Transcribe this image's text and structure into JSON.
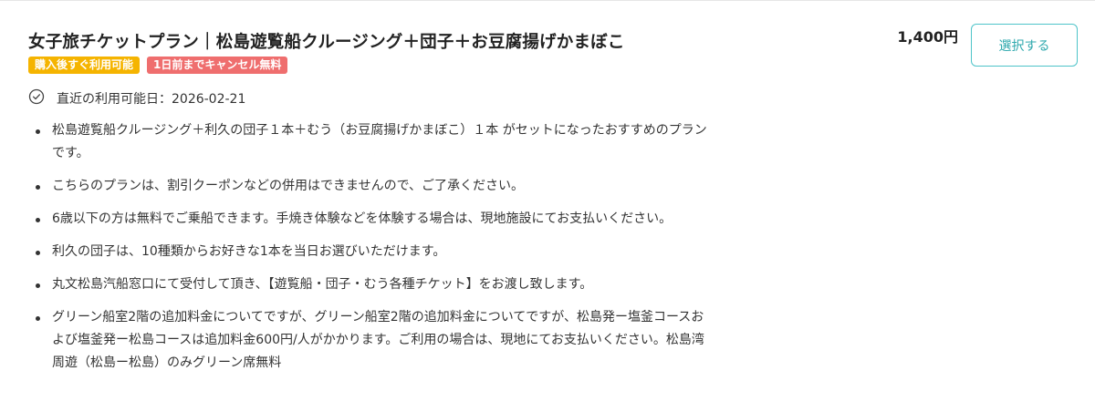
{
  "plan": {
    "title": "女子旅チケットプラン｜松島遊覧船クルージング＋団子＋お豆腐揚げかまぼこ",
    "badges": [
      {
        "label": "購入後すぐ利用可能",
        "color": "#f5b400"
      },
      {
        "label": "1日前までキャンセル無料",
        "color": "#ef6e6e"
      }
    ],
    "availability": "直近の利用可能日：2026-02-21",
    "description": [
      "松島遊覧船クルージング＋利久の団子１本＋むう（お豆腐揚げかまぼこ）１本 がセットになったおすすめのプランです。",
      "こちらのプランは、割引クーポンなどの併用はできませんので、ご了承ください。",
      "6歳以下の方は無料でご乗船できます。手焼き体験などを体験する場合は、現地施設にてお支払いください。",
      "利久の団子は、10種類からお好きな1本を当日お選びいただけます。",
      "丸文松島汽船窓口にて受付して頂き、【遊覧船・団子・むう各種チケット】をお渡し致します。",
      "グリーン船室2階の追加料金についてですが、グリーン船室2階の追加料金についてですが、松島発ー塩釜コースおよび塩釜発ー松島コースは追加料金600円/人がかかります。ご利用の場合は、現地にてお支払いください。松島湾周遊（松島ー松島）のみグリーン席無料"
    ],
    "price": "1,400円",
    "select_label": "選択する",
    "accent_color": "#4ec4c9"
  }
}
